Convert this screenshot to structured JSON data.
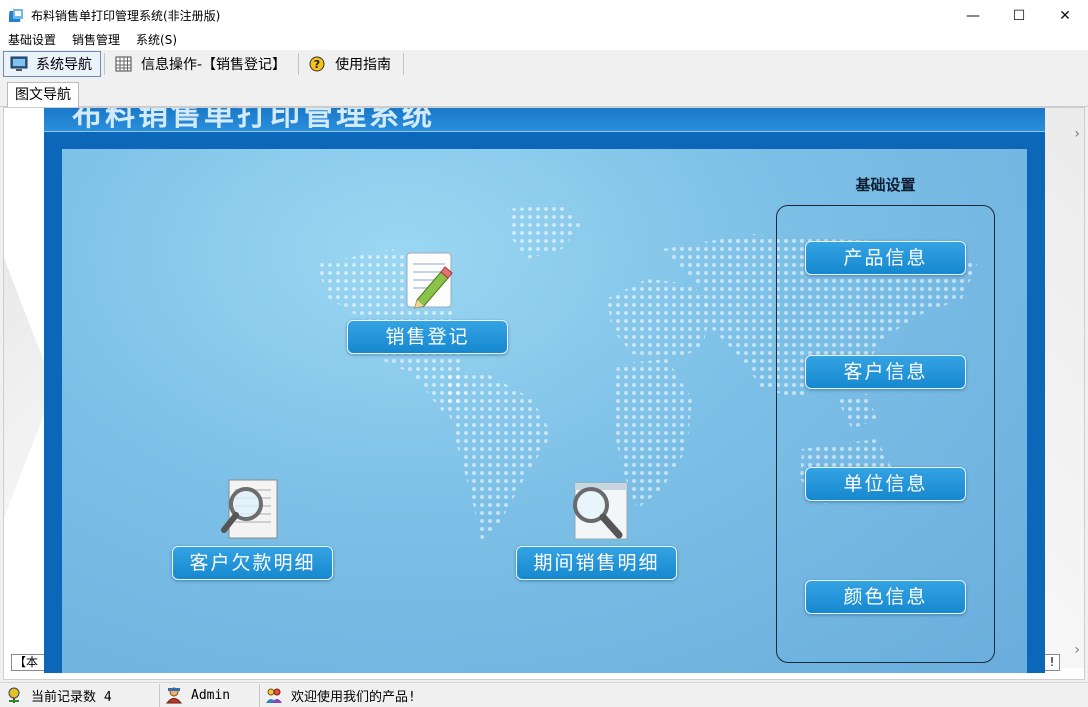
{
  "window": {
    "title": "布料销售单打印管理系统(非注册版)",
    "controls": {
      "minimize": "—",
      "maximize": "☐",
      "close": "✕"
    }
  },
  "menu": [
    "基础设置",
    "销售管理",
    "系统(S)"
  ],
  "toolbar": {
    "nav_label": "系统导航",
    "info_label": "信息操作-【销售登记】",
    "guide_label": "使用指南"
  },
  "tab": {
    "label": "图文导航"
  },
  "banner": {
    "title": "布料销售单打印管理系统"
  },
  "side_group": {
    "title": "基础设置"
  },
  "buttons": {
    "sales_register": "销售登记",
    "customer_debt": "客户欠款明细",
    "period_sales": "期间销售明细",
    "product_info": "产品信息",
    "customer_info": "客户信息",
    "unit_info": "单位信息",
    "color_info": "颜色信息"
  },
  "partial_labels": {
    "left": "【本",
    "right": "!"
  },
  "status": {
    "record_count": "当前记录数 4",
    "user": "Admin",
    "welcome": "欢迎使用我们的产品!"
  }
}
